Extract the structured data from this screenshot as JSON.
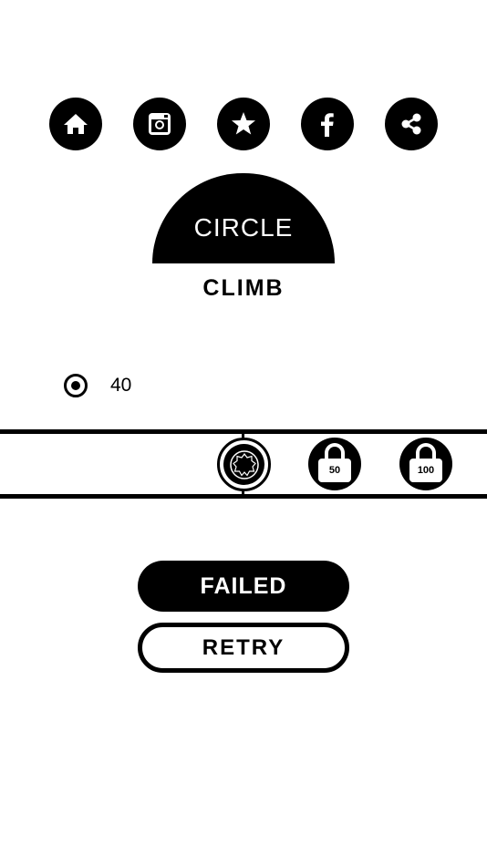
{
  "social_bar": {
    "buttons": [
      {
        "icon": "home-icon"
      },
      {
        "icon": "instagram-icon"
      },
      {
        "icon": "star-icon"
      },
      {
        "icon": "facebook-icon"
      },
      {
        "icon": "share-icon"
      }
    ]
  },
  "logo": {
    "top_text": "CIRCLE",
    "bottom_text": "CLIMB"
  },
  "score": {
    "icon": "target-icon",
    "value": "40"
  },
  "skins": {
    "selected_icon": "gear-ball-icon",
    "locked": [
      {
        "icon": "lock-icon",
        "cost": "50"
      },
      {
        "icon": "lock-icon",
        "cost": "100"
      }
    ]
  },
  "result": {
    "status_label": "FAILED",
    "retry_label": "RETRY"
  },
  "colors": {
    "background": "#ffffff",
    "foreground": "#000000"
  }
}
